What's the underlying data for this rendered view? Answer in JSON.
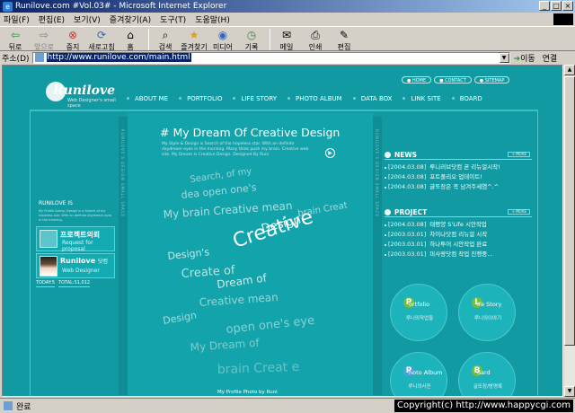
{
  "window": {
    "title": "Runilove.com #Vol.03# - Microsoft Internet Explorer",
    "ie_glyph": "e",
    "min_glyph": "_",
    "max_glyph": "□",
    "close_glyph": "×"
  },
  "menu": [
    "파일(F)",
    "편집(E)",
    "보기(V)",
    "즐겨찾기(A)",
    "도구(T)",
    "도움말(H)"
  ],
  "toolbar": {
    "back": "뒤로",
    "forward": "앞으로",
    "stop": "중지",
    "refresh": "새로고침",
    "home": "홈",
    "search": "검색",
    "favorites": "즐겨찾기",
    "media": "미디어",
    "history": "기록",
    "mail": "메일",
    "print": "인쇄",
    "edit": "편집"
  },
  "address": {
    "label": "주소(D)",
    "url": "http://www.runilove.com/main.html",
    "go": "이동",
    "links": "연결"
  },
  "status": {
    "text": "완료",
    "copyright": "Copyright(c) http://www.happycgi.com"
  },
  "site": {
    "logo_letter": "R",
    "logo_name": "unilove",
    "logo_tag": "Web Designer's small space",
    "toplinks": [
      "HOME",
      "CONTACT",
      "SITEMAP"
    ],
    "nav": [
      "ABOUT ME",
      "PORTFOLIO",
      "LIFE STORY",
      "PHOTO ALBUM",
      "DATA BOX",
      "LINK SITE",
      "BOARD"
    ],
    "left": {
      "title": "RUNILOVE IS",
      "tiny": "My Profile &amp; Design is a Search of my hopeless star. With an definite daydream eyes in the morning.",
      "banner1_title": "프로젝트의뢰",
      "banner1_sub": "Request for proposal",
      "banner2_title": "Runilove",
      "banner2_suffix": "닷컴",
      "banner2_sub": "Web Designer",
      "today": "TODAY:5",
      "total": "TOTAL:51,012"
    },
    "strip_left": "RUNILOVE'S DESIGN SMALL SPACE",
    "strip_right": "RUNILOVE'S DESIGN SMALL SPACE",
    "center": {
      "title": "# My Dream Of Creative Design",
      "sub": "My Style & Design is Search of the hopeless star. With an definite daydream eyes in the morning. Many think push my brain. Creative web site. My Dream Is Creative Design. Designed By Runi",
      "play": "▶",
      "foot": "My Profile Photo by Runi",
      "swirl_words": [
        "Search, of my",
        "dea open one's",
        "My brain Creative mean",
        "Design",
        "Creative",
        "Design's",
        "Create of",
        "brain Creat",
        "Dream of",
        "Creative mean",
        "Design",
        "open one's eye",
        "My Dream of",
        "brain Creat e"
      ]
    },
    "news": {
      "title": "NEWS",
      "more": "MORE",
      "items": [
        {
          "date": "[2004.03.08]",
          "text": "루니러브닷컴 곧 리뉴얼시작!"
        },
        {
          "date": "[2004.03.08]",
          "text": "포트폴리오 업데이트!"
        },
        {
          "date": "[2004.03.08]",
          "text": "글또장은 꼭 남겨주세염^.^"
        }
      ]
    },
    "project": {
      "title": "PROJECT",
      "more": "MORE",
      "items": [
        {
          "date": "[2004.03.08]",
          "text": "태평양 S'Life 시안작업"
        },
        {
          "date": "[2003.03.01]",
          "text": "차이나닷컴 리뉴얼 시작"
        },
        {
          "date": "[2003.03.01]",
          "text": "하나투어 시안작업 완료"
        },
        {
          "date": "[2003.03.01]",
          "text": "미사랑닷컴 작업 진행중..."
        }
      ]
    },
    "circles": [
      {
        "letter": "P",
        "title": "ortfolio",
        "sub": "루니의작업들",
        "color": "#6fbf3c"
      },
      {
        "letter": "L",
        "title": "ife Story",
        "sub": "루니의이야기",
        "color": "#6fbf3c"
      },
      {
        "letter": "P",
        "title": "hoto Album",
        "sub": "루니의사진",
        "color": "#4aa0d8"
      },
      {
        "letter": "B",
        "title": "oard",
        "sub": "글또장/방명록",
        "color": "#6fbf3c"
      }
    ]
  }
}
